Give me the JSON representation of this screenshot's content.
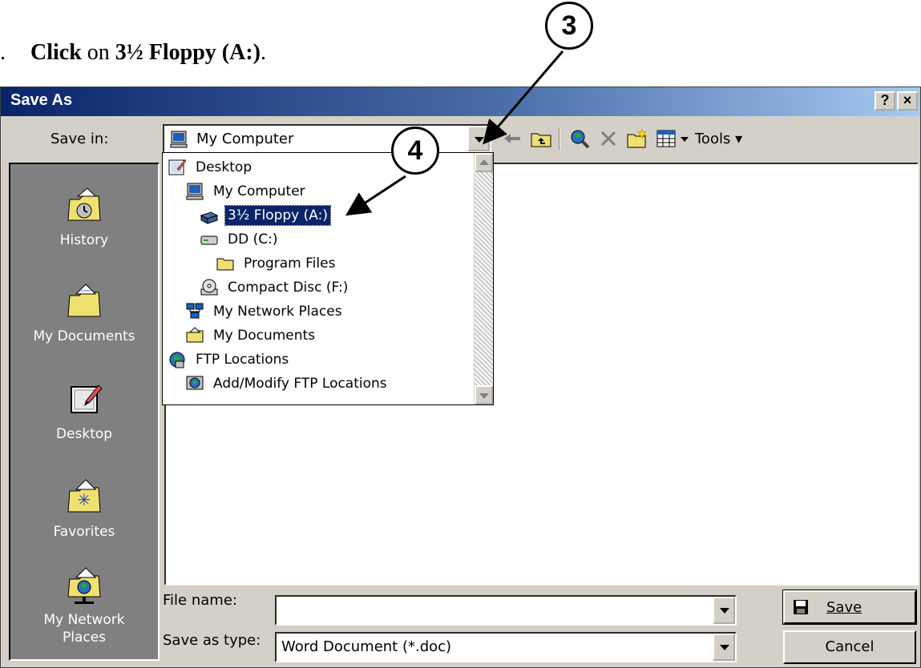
{
  "instruction": {
    "number": ".",
    "verb": "Click",
    "middle": " on ",
    "target": "3½ Floppy (A:)",
    "end": "."
  },
  "callouts": [
    "3",
    "4"
  ],
  "dialog": {
    "title": "Save As",
    "help_label": "?",
    "close_label": "×",
    "save_in_label": "Save in:",
    "save_in_value": "My Computer",
    "toolbar": {
      "tools_label": "Tools"
    },
    "places": [
      {
        "label": "History",
        "icon": "history-icon"
      },
      {
        "label": "My Documents",
        "icon": "my-documents-icon"
      },
      {
        "label": "Desktop",
        "icon": "desktop-icon"
      },
      {
        "label": "Favorites",
        "icon": "favorites-icon"
      },
      {
        "label": "My Network\nPlaces",
        "icon": "network-places-icon"
      }
    ],
    "dropdown_items": [
      {
        "label": "Desktop",
        "icon": "desktop-icon",
        "indent": 0,
        "selected": false
      },
      {
        "label": "My Computer",
        "icon": "computer-icon",
        "indent": 1,
        "selected": false
      },
      {
        "label": "3½ Floppy (A:)",
        "icon": "floppy-drive-icon",
        "indent": 2,
        "selected": true
      },
      {
        "label": "DD (C:)",
        "icon": "hard-drive-icon",
        "indent": 2,
        "selected": false
      },
      {
        "label": "Program Files",
        "icon": "folder-icon",
        "indent": 3,
        "selected": false
      },
      {
        "label": "Compact Disc (F:)",
        "icon": "cd-drive-icon",
        "indent": 2,
        "selected": false
      },
      {
        "label": "My Network Places",
        "icon": "network-places-icon",
        "indent": 1,
        "selected": false
      },
      {
        "label": "My Documents",
        "icon": "my-documents-icon",
        "indent": 1,
        "selected": false
      },
      {
        "label": "FTP Locations",
        "icon": "ftp-icon",
        "indent": 0,
        "selected": false
      },
      {
        "label": "Add/Modify FTP Locations",
        "icon": "ftp-add-icon",
        "indent": 1,
        "selected": false
      }
    ],
    "file_name_label": "File name:",
    "file_name_value": "",
    "save_type_label": "Save as type:",
    "save_type_value": "Word Document (*.doc)",
    "save_button": "Save",
    "cancel_button": "Cancel"
  }
}
